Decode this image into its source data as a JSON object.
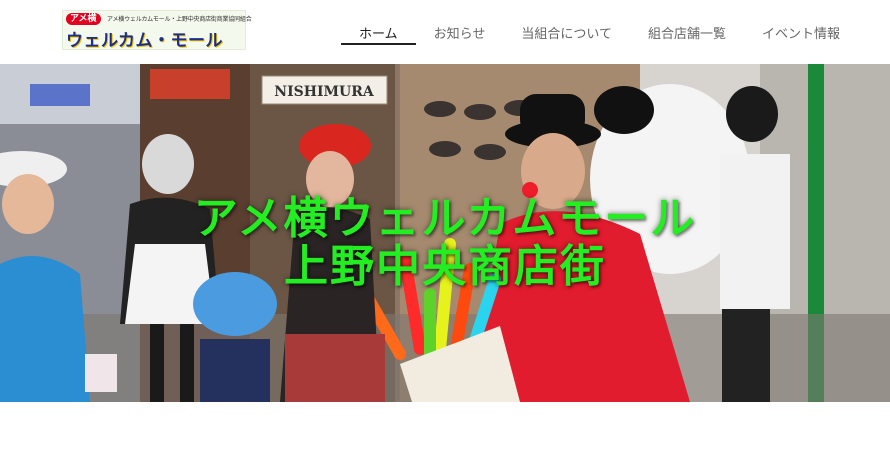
{
  "logo": {
    "badge": "アメ横",
    "subtitle": "アメ横ウェルカムモール・上野中央商店街商業協同組合",
    "main": "ウェルカム・モール"
  },
  "nav": [
    {
      "label": "ホーム",
      "active": true
    },
    {
      "label": "お知らせ",
      "active": false
    },
    {
      "label": "当組合について",
      "active": false
    },
    {
      "label": "組合店舗一覧",
      "active": false
    },
    {
      "label": "イベント情報",
      "active": false
    }
  ],
  "hero": {
    "title_line1": "アメ横ウェルカムモール",
    "title_line2": "上野中央商店街",
    "sign_text": "NISHIMURA",
    "title_color": "#22ee22"
  }
}
